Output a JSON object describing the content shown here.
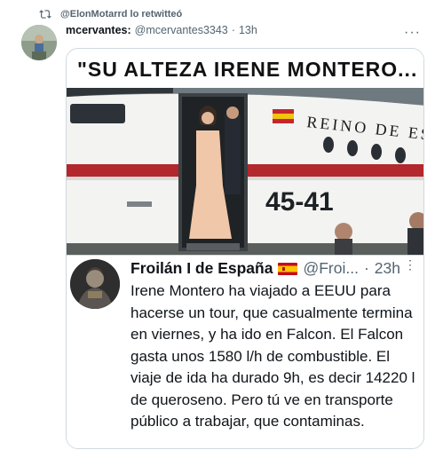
{
  "retweet": {
    "icon": "retweet-icon",
    "text": "@ElonMotarrd lo retwitteó"
  },
  "tweet": {
    "display_name": "mcervantes:",
    "handle": "@mcervantes3343",
    "separator": "·",
    "time": "13h",
    "more_icon": "more-dots-icon",
    "more_glyph": "···"
  },
  "media": {
    "title": "\"SU ALTEZA IRENE MONTERO...",
    "plane_text": "REINO DE ES",
    "plane_number": "45-41"
  },
  "quoted": {
    "display_name": "Froilán I de España",
    "flag_icon": "spain-flag-icon",
    "handle": "@Froi...",
    "separator": "·",
    "time": "23h",
    "more_icon": "more-vertical-icon",
    "more_glyph": "⋮",
    "body": "Irene Montero ha viajado a EEUU para hacerse un tour, que casualmente termina en viernes, y ha ido en Falcon. El Falcon gasta unos 1580 l/h de combustible. El viaje de ida ha durado 9h, es decir 14220 l de queroseno. Pero tú ve en transporte público a trabajar, que contaminas."
  },
  "colors": {
    "text_primary": "#0f1419",
    "text_secondary": "#536471",
    "border": "#cfd9de",
    "plane_stripe": "#b3282d"
  }
}
